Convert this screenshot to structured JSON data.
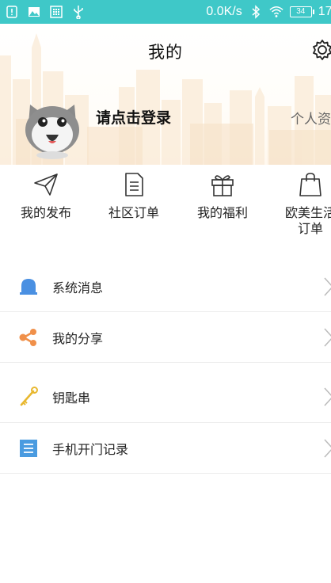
{
  "status_bar": {
    "network_speed": "0.0K/s",
    "battery": "34",
    "time": "17:"
  },
  "header": {
    "title": "我的",
    "login_prompt": "请点击登录",
    "profile_link": "个人资"
  },
  "actions": [
    {
      "label": "我的发布",
      "icon": "paper-plane-icon"
    },
    {
      "label": "社区订单",
      "icon": "document-icon"
    },
    {
      "label": "我的福利",
      "icon": "gift-icon"
    },
    {
      "label": "欧美生活订单",
      "label_line1": "欧美生活",
      "label_line2": "订单",
      "icon": "shopping-bag-icon"
    }
  ],
  "menu": [
    {
      "label": "系统消息",
      "icon": "bell-icon",
      "color": "#4a90e2"
    },
    {
      "label": "我的分享",
      "icon": "share-icon",
      "color": "#f0904a"
    },
    {
      "label": "钥匙串",
      "icon": "key-icon",
      "color": "#e8b830"
    },
    {
      "label": "手机开门记录",
      "icon": "list-icon",
      "color": "#4a9be0"
    }
  ],
  "colors": {
    "status_bar": "#3fc8c8",
    "text": "#222222"
  }
}
